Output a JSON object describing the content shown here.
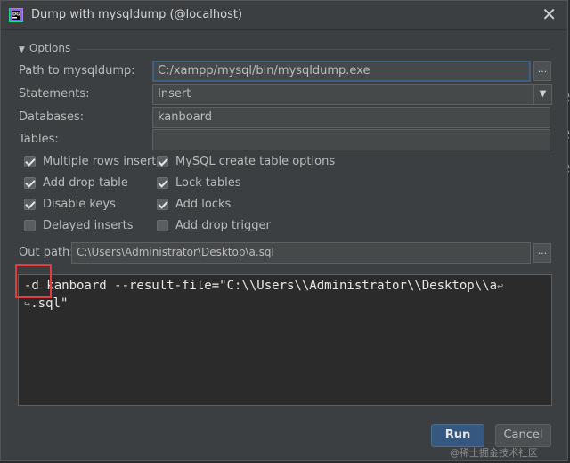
{
  "window": {
    "title": "Dump with mysqldump (@localhost)",
    "close_symbol": "✕"
  },
  "options": {
    "section_label": "Options",
    "path_label": "Path to mysqldump:",
    "path_value": "C:/xampp/mysql/bin/mysqldump.exe",
    "statements_label": "Statements:",
    "statements_value": "Insert",
    "databases_label": "Databases:",
    "databases_value": "kanboard",
    "tables_label": "Tables:",
    "tables_value": "",
    "browse_label": "...",
    "checkboxes": [
      {
        "label": "Multiple rows inserts",
        "checked": true
      },
      {
        "label": "MySQL create table options",
        "checked": true
      },
      {
        "label": "Add drop table",
        "checked": true
      },
      {
        "label": "Lock tables",
        "checked": true
      },
      {
        "label": "Disable keys",
        "checked": true
      },
      {
        "label": "Add locks",
        "checked": true
      },
      {
        "label": "Delayed inserts",
        "checked": false
      },
      {
        "label": "Add drop trigger",
        "checked": false
      }
    ],
    "out_path_label": "Out path:",
    "out_path_value": "C:\\Users\\Administrator\\Desktop\\a.sql"
  },
  "command": {
    "line1": "-d kanboard --result-file=\"C:\\\\Users\\\\Administrator\\\\Desktop\\\\a",
    "line2": ".sql\"",
    "wrap_end_symbol": "↩",
    "wrap_start_symbol": "↪"
  },
  "buttons": {
    "run": "Run",
    "cancel": "Cancel"
  },
  "watermark": "@稀土掘金技术社区",
  "background_chars": [
    "e",
    "e",
    "e"
  ]
}
